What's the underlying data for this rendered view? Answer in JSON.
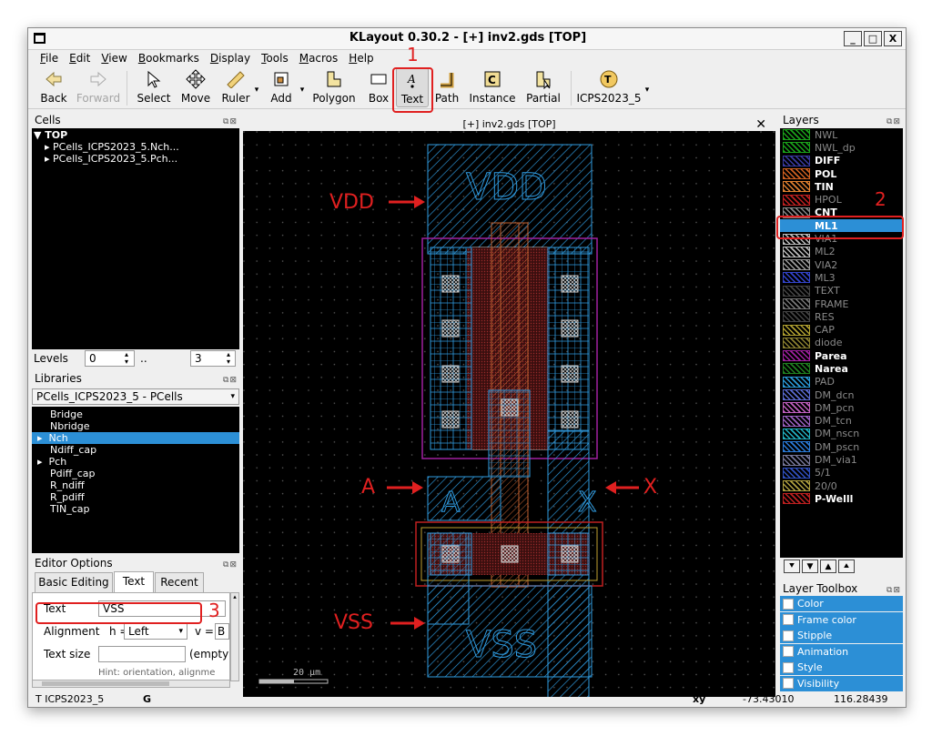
{
  "window": {
    "title": "KLayout 0.30.2 - [+] inv2.gds [TOP]",
    "min": "_",
    "max": "□",
    "close": "X"
  },
  "menu": [
    "File",
    "Edit",
    "View",
    "Bookmarks",
    "Display",
    "Tools",
    "Macros",
    "Help"
  ],
  "toolbar": {
    "back": "Back",
    "forward": "Forward",
    "select": "Select",
    "move": "Move",
    "ruler": "Ruler",
    "add": "Add",
    "polygon": "Polygon",
    "box": "Box",
    "text": "Text",
    "path": "Path",
    "instance": "Instance",
    "partial": "Partial",
    "macro": "ICPS2023_5"
  },
  "annotations": {
    "n1": "1",
    "n2": "2",
    "n3": "3",
    "vdd": "VDD",
    "a": "A",
    "x": "X",
    "vss": "VSS"
  },
  "cells": {
    "title": "Cells",
    "top": "TOP",
    "children": [
      "PCells_ICPS2023_5.Nch...",
      "PCells_ICPS2023_5.Pch..."
    ]
  },
  "levels": {
    "label": "Levels",
    "from": "0",
    "sep": "..",
    "to": "3"
  },
  "libraries": {
    "title": "Libraries",
    "selected": "PCells_ICPS2023_5 - PCells",
    "items": [
      "Bridge",
      "Nbridge",
      "Nch",
      "Ndiff_cap",
      "Pch",
      "Pdiff_cap",
      "R_ndiff",
      "R_pdiff",
      "TIN_cap"
    ]
  },
  "editor": {
    "title": "Editor Options",
    "tabs": [
      "Basic Editing",
      "Text",
      "Recent"
    ],
    "text_label": "Text",
    "text_value": "VSS",
    "align_label": "Alignment",
    "h_label": "h =",
    "h_value": "Left",
    "v_label": "v =",
    "v_value": "B",
    "size_label": "Text size",
    "size_hint": "(empty",
    "hint": "Hint: orientation, alignme"
  },
  "canvas": {
    "tab": "[+] inv2.gds [TOP]",
    "close": "✕",
    "scale": "20 µm",
    "labels": {
      "vdd": "VDD",
      "a": "A",
      "x": "X",
      "vss": "VSS"
    }
  },
  "layers": {
    "title": "Layers",
    "items": [
      {
        "name": "NWL",
        "style": "dim"
      },
      {
        "name": "NWL_dp",
        "style": "dim"
      },
      {
        "name": "DIFF",
        "style": "bold"
      },
      {
        "name": "POL",
        "style": "bold"
      },
      {
        "name": "TIN",
        "style": "bold"
      },
      {
        "name": "HPOL",
        "style": "dim"
      },
      {
        "name": "CNT",
        "style": "bold"
      },
      {
        "name": "ML1",
        "style": "sel"
      },
      {
        "name": "VIA1",
        "style": "dim"
      },
      {
        "name": "ML2",
        "style": "dim"
      },
      {
        "name": "VIA2",
        "style": "dim"
      },
      {
        "name": "ML3",
        "style": "dim"
      },
      {
        "name": "TEXT",
        "style": "dim"
      },
      {
        "name": "FRAME",
        "style": "dim"
      },
      {
        "name": "RES",
        "style": "dim"
      },
      {
        "name": "CAP",
        "style": "dim"
      },
      {
        "name": "diode",
        "style": "dim"
      },
      {
        "name": "Parea",
        "style": "bold"
      },
      {
        "name": "Narea",
        "style": "bold"
      },
      {
        "name": "PAD",
        "style": "dim"
      },
      {
        "name": "DM_dcn",
        "style": "dim"
      },
      {
        "name": "DM_pcn",
        "style": "dim"
      },
      {
        "name": "DM_tcn",
        "style": "dim"
      },
      {
        "name": "DM_nscn",
        "style": "dim"
      },
      {
        "name": "DM_pscn",
        "style": "dim"
      },
      {
        "name": "DM_via1",
        "style": "dim"
      },
      {
        "name": "5/1",
        "style": "dim"
      },
      {
        "name": "20/0",
        "style": "dim"
      },
      {
        "name": "P-Welll",
        "style": "bold"
      }
    ],
    "colors": [
      "#1aa31a",
      "#1aa31a",
      "#3a3aa0",
      "#d06020",
      "#e08030",
      "#c02020",
      "#888888",
      "#2c8fd6",
      "#bbbbbb",
      "#bbbbbb",
      "#999999",
      "#3344cc",
      "#444444",
      "#777777",
      "#444444",
      "#b0a030",
      "#8a8030",
      "#a020a0",
      "#208020",
      "#2a9ad8",
      "#5a6ad0",
      "#c060c0",
      "#9a60c0",
      "#20b0c0",
      "#2a7ad8",
      "#777799",
      "#3050c0",
      "#b0a040",
      "#c02020"
    ]
  },
  "layer_toolbox": {
    "title": "Layer Toolbox",
    "items": [
      "Color",
      "Frame color",
      "Stipple",
      "Animation",
      "Style",
      "Visibility"
    ]
  },
  "status": {
    "cell": "T ICPS2023_5",
    "g": "G",
    "xy": "xy",
    "x": "-73.43010",
    "y": "116.28439"
  }
}
